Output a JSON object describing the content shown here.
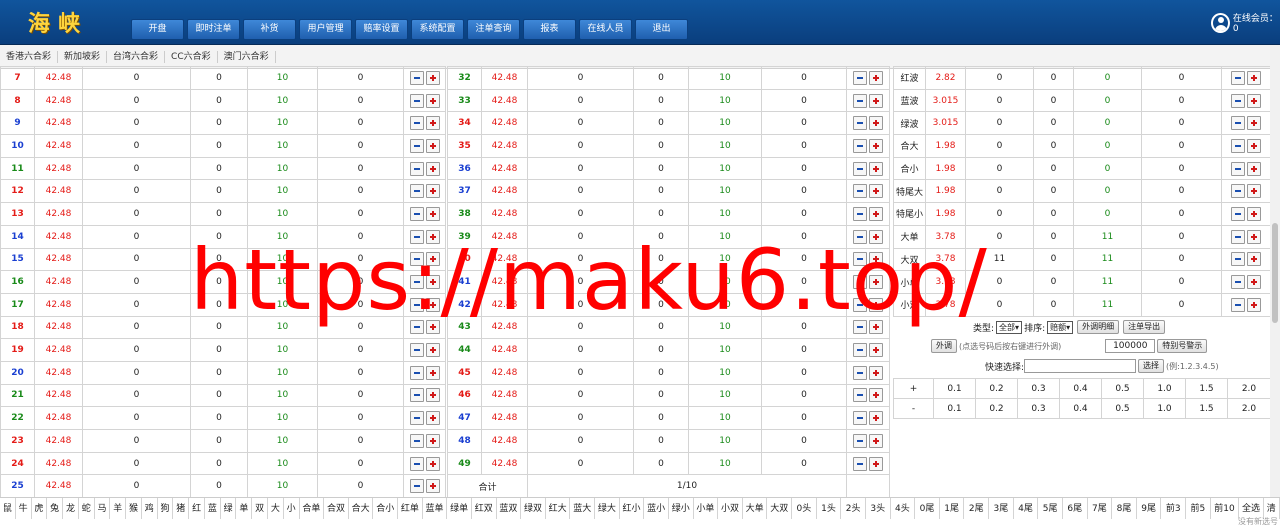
{
  "header": {
    "logo": "海峡",
    "online_label": "在线会员：0",
    "nav": [
      "开盘",
      "即时注单",
      "补货",
      "用户管理",
      "赔率设置",
      "系统配置",
      "注单查询",
      "报表",
      "在线人员",
      "退出"
    ]
  },
  "lottery_tabs": [
    "香港六合彩",
    "新加坡彩",
    "台湾六合彩",
    "CC六合彩",
    "澳门六合彩"
  ],
  "left_rows": [
    {
      "num": "7",
      "color": "red",
      "odds": "42.48",
      "a": "0",
      "b": "0",
      "c": "10",
      "d": "0"
    },
    {
      "num": "8",
      "color": "red",
      "odds": "42.48",
      "a": "0",
      "b": "0",
      "c": "10",
      "d": "0"
    },
    {
      "num": "9",
      "color": "blue",
      "odds": "42.48",
      "a": "0",
      "b": "0",
      "c": "10",
      "d": "0"
    },
    {
      "num": "10",
      "color": "blue",
      "odds": "42.48",
      "a": "0",
      "b": "0",
      "c": "10",
      "d": "0"
    },
    {
      "num": "11",
      "color": "green",
      "odds": "42.48",
      "a": "0",
      "b": "0",
      "c": "10",
      "d": "0"
    },
    {
      "num": "12",
      "color": "red",
      "odds": "42.48",
      "a": "0",
      "b": "0",
      "c": "10",
      "d": "0"
    },
    {
      "num": "13",
      "color": "red",
      "odds": "42.48",
      "a": "0",
      "b": "0",
      "c": "10",
      "d": "0"
    },
    {
      "num": "14",
      "color": "blue",
      "odds": "42.48",
      "a": "0",
      "b": "0",
      "c": "10",
      "d": "0"
    },
    {
      "num": "15",
      "color": "blue",
      "odds": "42.48",
      "a": "0",
      "b": "0",
      "c": "10",
      "d": "0"
    },
    {
      "num": "16",
      "color": "green",
      "odds": "42.48",
      "a": "0",
      "b": "0",
      "c": "10",
      "d": "0"
    },
    {
      "num": "17",
      "color": "green",
      "odds": "42.48",
      "a": "0",
      "b": "0",
      "c": "10",
      "d": "0"
    },
    {
      "num": "18",
      "color": "red",
      "odds": "42.48",
      "a": "0",
      "b": "0",
      "c": "10",
      "d": "0"
    },
    {
      "num": "19",
      "color": "red",
      "odds": "42.48",
      "a": "0",
      "b": "0",
      "c": "10",
      "d": "0"
    },
    {
      "num": "20",
      "color": "blue",
      "odds": "42.48",
      "a": "0",
      "b": "0",
      "c": "10",
      "d": "0"
    },
    {
      "num": "21",
      "color": "green",
      "odds": "42.48",
      "a": "0",
      "b": "0",
      "c": "10",
      "d": "0"
    },
    {
      "num": "22",
      "color": "green",
      "odds": "42.48",
      "a": "0",
      "b": "0",
      "c": "10",
      "d": "0"
    },
    {
      "num": "23",
      "color": "red",
      "odds": "42.48",
      "a": "0",
      "b": "0",
      "c": "10",
      "d": "0"
    },
    {
      "num": "24",
      "color": "red",
      "odds": "42.48",
      "a": "0",
      "b": "0",
      "c": "10",
      "d": "0"
    },
    {
      "num": "25",
      "color": "blue",
      "odds": "42.48",
      "a": "0",
      "b": "0",
      "c": "10",
      "d": "0"
    }
  ],
  "mid_rows": [
    {
      "num": "32",
      "color": "green",
      "odds": "42.48",
      "a": "0",
      "b": "0",
      "c": "10",
      "d": "0"
    },
    {
      "num": "33",
      "color": "green",
      "odds": "42.48",
      "a": "0",
      "b": "0",
      "c": "10",
      "d": "0"
    },
    {
      "num": "34",
      "color": "red",
      "odds": "42.48",
      "a": "0",
      "b": "0",
      "c": "10",
      "d": "0"
    },
    {
      "num": "35",
      "color": "red",
      "odds": "42.48",
      "a": "0",
      "b": "0",
      "c": "10",
      "d": "0"
    },
    {
      "num": "36",
      "color": "blue",
      "odds": "42.48",
      "a": "0",
      "b": "0",
      "c": "10",
      "d": "0"
    },
    {
      "num": "37",
      "color": "blue",
      "odds": "42.48",
      "a": "0",
      "b": "0",
      "c": "10",
      "d": "0"
    },
    {
      "num": "38",
      "color": "green",
      "odds": "42.48",
      "a": "0",
      "b": "0",
      "c": "10",
      "d": "0"
    },
    {
      "num": "39",
      "color": "green",
      "odds": "42.48",
      "a": "0",
      "b": "0",
      "c": "10",
      "d": "0"
    },
    {
      "num": "40",
      "color": "red",
      "odds": "42.48",
      "a": "0",
      "b": "0",
      "c": "10",
      "d": "0"
    },
    {
      "num": "41",
      "color": "blue",
      "odds": "42.48",
      "a": "0",
      "b": "0",
      "c": "10",
      "d": "0"
    },
    {
      "num": "42",
      "color": "blue",
      "odds": "42.48",
      "a": "0",
      "b": "0",
      "c": "10",
      "d": "0"
    },
    {
      "num": "43",
      "color": "green",
      "odds": "42.48",
      "a": "0",
      "b": "0",
      "c": "10",
      "d": "0"
    },
    {
      "num": "44",
      "color": "green",
      "odds": "42.48",
      "a": "0",
      "b": "0",
      "c": "10",
      "d": "0"
    },
    {
      "num": "45",
      "color": "red",
      "odds": "42.48",
      "a": "0",
      "b": "0",
      "c": "10",
      "d": "0"
    },
    {
      "num": "46",
      "color": "red",
      "odds": "42.48",
      "a": "0",
      "b": "0",
      "c": "10",
      "d": "0"
    },
    {
      "num": "47",
      "color": "blue",
      "odds": "42.48",
      "a": "0",
      "b": "0",
      "c": "10",
      "d": "0"
    },
    {
      "num": "48",
      "color": "blue",
      "odds": "42.48",
      "a": "0",
      "b": "0",
      "c": "10",
      "d": "0"
    },
    {
      "num": "49",
      "color": "green",
      "odds": "42.48",
      "a": "0",
      "b": "0",
      "c": "10",
      "d": "0"
    }
  ],
  "mid_total": {
    "label": "合计",
    "page": "1/10"
  },
  "right_rows": [
    {
      "name": "红波",
      "odds": "2.82",
      "a": "0",
      "b": "0",
      "c": "0",
      "d": "0"
    },
    {
      "name": "蓝波",
      "odds": "3.015",
      "a": "0",
      "b": "0",
      "c": "0",
      "d": "0"
    },
    {
      "name": "绿波",
      "odds": "3.015",
      "a": "0",
      "b": "0",
      "c": "0",
      "d": "0"
    },
    {
      "name": "合大",
      "odds": "1.98",
      "a": "0",
      "b": "0",
      "c": "0",
      "d": "0"
    },
    {
      "name": "合小",
      "odds": "1.98",
      "a": "0",
      "b": "0",
      "c": "0",
      "d": "0"
    },
    {
      "name": "特尾大",
      "odds": "1.98",
      "a": "0",
      "b": "0",
      "c": "0",
      "d": "0"
    },
    {
      "name": "特尾小",
      "odds": "1.98",
      "a": "0",
      "b": "0",
      "c": "0",
      "d": "0"
    },
    {
      "name": "大单",
      "odds": "3.78",
      "a": "0",
      "b": "0",
      "c": "11",
      "d": "0"
    },
    {
      "name": "大双",
      "odds": "3.78",
      "a": "11",
      "b": "0",
      "c": "11",
      "d": "0"
    },
    {
      "name": "小单",
      "odds": "3.78",
      "a": "0",
      "b": "0",
      "c": "11",
      "d": "0"
    },
    {
      "name": "小双",
      "odds": "3.78",
      "a": "0",
      "b": "0",
      "c": "11",
      "d": "0"
    }
  ],
  "controls": {
    "type_label": "类型:",
    "type_value": "全部",
    "sort_label": "排序:",
    "sort_value": "赔额",
    "btn_external_detail": "外调明细",
    "btn_export": "注单导出",
    "btn_external": "外调",
    "external_hint": "(点选号码后按右键进行外调)",
    "amount": "100000",
    "btn_special_warn": "特别号警示",
    "quick_label": "快速选择:",
    "quick_btn": "选择",
    "quick_hint": "(例:1.2.3.4.5)"
  },
  "rebate": {
    "rows": [
      {
        "sign": "+",
        "vals": [
          "0.1",
          "0.2",
          "0.3",
          "0.4",
          "0.5",
          "1.0",
          "1.5",
          "2.0"
        ]
      },
      {
        "sign": "-",
        "vals": [
          "0.1",
          "0.2",
          "0.3",
          "0.4",
          "0.5",
          "1.0",
          "1.5",
          "2.0"
        ]
      }
    ]
  },
  "quick_select": [
    "鼠",
    "牛",
    "虎",
    "兔",
    "龙",
    "蛇",
    "马",
    "羊",
    "猴",
    "鸡",
    "狗",
    "猪",
    "红",
    "蓝",
    "绿",
    "单",
    "双",
    "大",
    "小",
    "合单",
    "合双",
    "合大",
    "合小",
    "红单",
    "蓝单",
    "绿单",
    "红双",
    "蓝双",
    "绿双",
    "红大",
    "蓝大",
    "绿大",
    "红小",
    "蓝小",
    "绿小",
    "小单",
    "小双",
    "大单",
    "大双",
    "0头",
    "1头",
    "2头",
    "3头",
    "4头",
    "0尾",
    "1尾",
    "2尾",
    "3尾",
    "4尾",
    "5尾",
    "6尾",
    "7尾",
    "8尾",
    "9尾",
    "前3",
    "前5",
    "前10",
    "全选",
    "清"
  ],
  "footer": {
    "no_new": "没有新选号"
  },
  "watermark": "https://maku6.top/",
  "colors": {
    "red": "#e41b17",
    "blue": "#1a3fd1",
    "green": "#198a19",
    "header": "#0a3e7d"
  }
}
